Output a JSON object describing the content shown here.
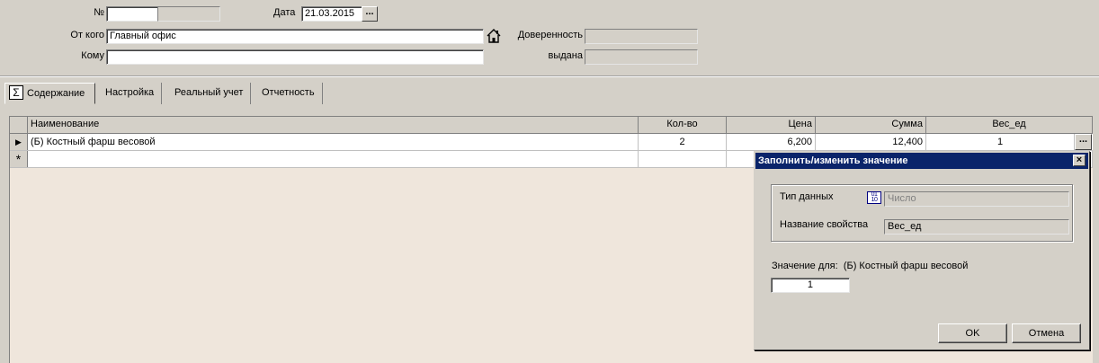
{
  "header": {
    "number_label": "№",
    "number_value": "",
    "date_label": "Дата",
    "date_value": "21.03.2015",
    "date_picker_glyph": "...",
    "from_label": "От кого",
    "from_value": "Главный офис",
    "to_label": "Кому",
    "to_value": "",
    "proxy_label": "Доверенность",
    "proxy_value": "",
    "issued_label": "выдана",
    "issued_value": ""
  },
  "tabs": [
    {
      "label": "Содержание",
      "icon": "sigma-icon",
      "active": true
    },
    {
      "label": "Настройка",
      "active": false
    },
    {
      "label": "Реальный учет",
      "active": false
    },
    {
      "label": "Отчетность",
      "active": false
    }
  ],
  "grid": {
    "columns": [
      "Наименование",
      "Кол-во",
      "Цена",
      "Сумма",
      "Вес_ед"
    ],
    "rows": [
      {
        "marker": "▶",
        "name": "(Б) Костный фарш весовой",
        "qty": "2",
        "price": "6,200",
        "sum": "12,400",
        "weight": "1",
        "edit_glyph": "..."
      }
    ],
    "new_row_marker": "*"
  },
  "dialog": {
    "title": "Заполнить/изменить значение",
    "close_glyph": "×",
    "data_type_label": "Тип данных",
    "data_type_value": "Число",
    "data_type_icon": "number-type-icon",
    "property_label": "Название свойства",
    "property_value": "Вес_ед",
    "value_for_label": "Значение для:",
    "value_for_item": "(Б) Костный фарш весовой",
    "value_input": "1",
    "ok_label": "OK",
    "cancel_label": "Отмена"
  },
  "colors": {
    "window_bg": "#d4d0c8",
    "grid_bg": "#efe6dc",
    "titlebar": "#0a246a"
  }
}
